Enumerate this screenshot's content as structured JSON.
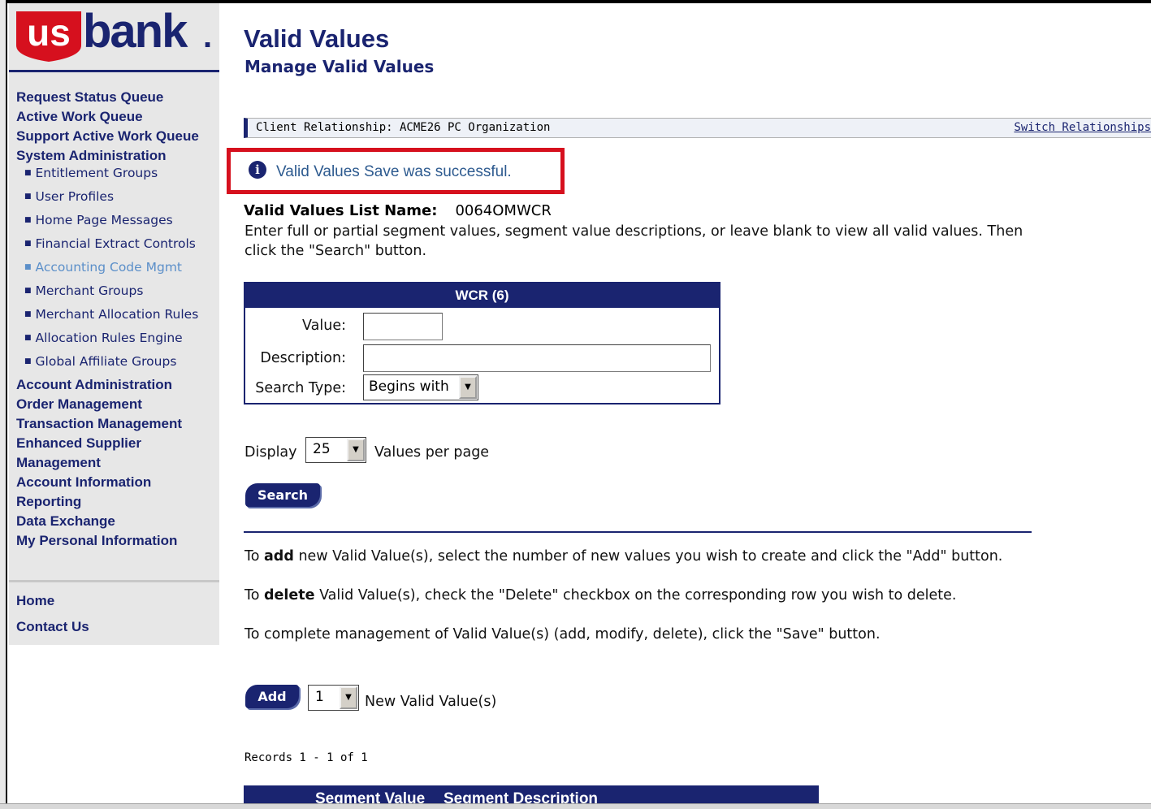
{
  "brand": {
    "logo_us": "us",
    "logo_bank": "bank",
    "logo_dot": ".",
    "red": "#d6101e",
    "navy": "#1a2470"
  },
  "nav": {
    "main_top": [
      "Request Status Queue",
      "Active Work Queue",
      "Support Active Work Queue",
      "System Administration"
    ],
    "sub": [
      "Entitlement Groups",
      "User Profiles",
      "Home Page Messages",
      "Financial Extract Controls",
      "Accounting Code Mgmt",
      "Merchant Groups",
      "Merchant Allocation Rules",
      "Allocation Rules Engine",
      "Global Affiliate Groups"
    ],
    "main_bottom": [
      "Account Administration",
      "Order Management",
      "Transaction Management",
      "Enhanced Supplier Management",
      "Account Information",
      "Reporting",
      "Data Exchange",
      "My Personal Information"
    ],
    "footer": [
      "Home",
      "Contact Us"
    ]
  },
  "header": {
    "title": "Valid Values",
    "subtitle": "Manage Valid Values"
  },
  "client_bar": {
    "label": "Client Relationship: ACME26 PC Organization",
    "switch_link": "Switch Relationships"
  },
  "message": {
    "text": "Valid Values Save was successful."
  },
  "list": {
    "name_label": "Valid Values List Name:",
    "name_value": "0064OMWCR",
    "instructions": "Enter full or partial segment values, segment value descriptions, or leave blank to view all valid values. Then click the \"Search\" button."
  },
  "search_panel": {
    "title": "WCR (6)",
    "value_label": "Value:",
    "value": "",
    "description_label": "Description:",
    "description": "",
    "search_type_label": "Search Type:",
    "search_type_selected": "Begins with"
  },
  "display": {
    "prefix": "Display",
    "selected": "25",
    "suffix": "Values per page"
  },
  "search_button": "Search",
  "paragraphs": {
    "add_pre": "To ",
    "add_bold": "add",
    "add_post": " new Valid Value(s), select the number of new values you wish to create and click the \"Add\" button.",
    "delete_pre": "To ",
    "delete_bold": "delete",
    "delete_post": " Valid Value(s), check the \"Delete\" checkbox on the corresponding row you wish to delete.",
    "save": "To complete management of Valid Value(s) (add, modify, delete), click the \"Save\" button."
  },
  "add_row": {
    "button": "Add",
    "selected": "1",
    "suffix": "New Valid Value(s)"
  },
  "records": "Records 1 - 1 of 1",
  "results_table": {
    "columns": [
      "Segment Value",
      "Segment Description"
    ]
  },
  "icons": {
    "info": "info-circle-icon",
    "dropdown": "chevron-down-icon"
  }
}
